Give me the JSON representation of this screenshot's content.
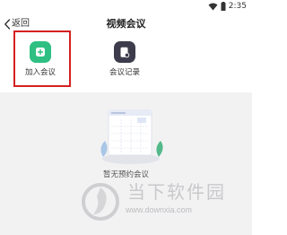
{
  "status_bar": {
    "time": "2:35",
    "icons": [
      "wifi-icon",
      "battery-icon"
    ]
  },
  "nav": {
    "back_label": "返回",
    "title": "视频会议"
  },
  "actions": [
    {
      "label": "加入会议",
      "icon": "plus-icon",
      "color": "#2fbf82",
      "highlighted": true
    },
    {
      "label": "会议记录",
      "icon": "document-icon",
      "color": "#3c3c4c",
      "highlighted": false
    }
  ],
  "empty_state": {
    "text": "暂无预约会议"
  },
  "watermark": {
    "text": "当下软件园",
    "url": "www.downxia.com"
  },
  "colors": {
    "highlight": "#d42020",
    "content_bg": "#f2f2f3"
  }
}
